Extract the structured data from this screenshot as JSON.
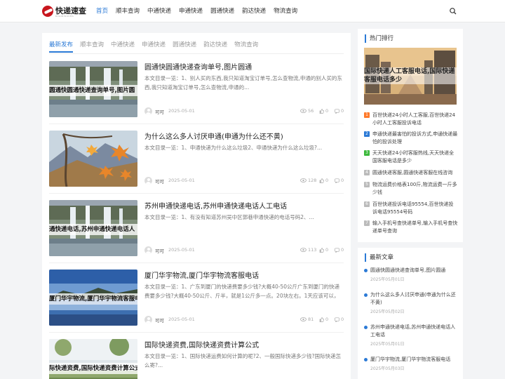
{
  "brand": {
    "name": "快递速查",
    "tagline": "KUAIDISUCHA"
  },
  "nav": [
    "首页",
    "顺丰查询",
    "中通快递",
    "申通快递",
    "圆通快递",
    "韵达快递",
    "物流查询"
  ],
  "tabs": [
    "最新发布",
    "顺丰查询",
    "中通快递",
    "申通快递",
    "圆通快递",
    "韵达快递",
    "物流查询"
  ],
  "posts": [
    {
      "thumb_text": "圆通快圆通快递查询单号,图片圆",
      "title": "圆通快圆通快递查询单号,图片圆通",
      "excerpt": "本文目录一览：1、别人买的东西,我只知道淘宝订单号,怎么查物流,申通的别人买的东西,我只知道淘宝订单号,怎么查物流,申通的...",
      "author": "可可",
      "date": "2025-05-01",
      "views": "56",
      "likes": "0",
      "comments": "0",
      "thumb_style": "waterfall"
    },
    {
      "thumb_text": "",
      "title": "为什么这么多人讨厌申通(申通为什么还不黄)",
      "excerpt": "本文目录一览：1、申通快递为什么这么垃圾2、申通快递为什么这么垃圾?...",
      "author": "可可",
      "date": "2025-05-01",
      "views": "128",
      "likes": "0",
      "comments": "0",
      "thumb_style": "autumn"
    },
    {
      "thumb_text": "通快递电话,苏州申通快递电话人",
      "title": "苏州申通快递电话,苏州申通快递电话人工电话",
      "excerpt": "本文目录一览：1、有没有知道苏州吴中区郭巷申通快递的电话号码2、...",
      "author": "可可",
      "date": "2025-05-01",
      "views": "113",
      "likes": "0",
      "comments": "0",
      "thumb_style": "waterfall"
    },
    {
      "thumb_text": "厦门华宇物流,厦门华宇物流客服电",
      "title": "厦门华宇物流,厦门华宇物流客服电话",
      "excerpt": "本文目录一览：1、广东到厦门的快递费要多少钱?大概40-50公斤广东到厦门的快递费要多少钱?大概40-50公斤、斤半，就是1公斤多一点。20块左右。1天应该可以，申通",
      "author": "可可",
      "date": "2025-05-01",
      "views": "81",
      "likes": "0",
      "comments": "0",
      "thumb_style": "lake"
    },
    {
      "thumb_text": "际快递资费,国际快递资费计算公式",
      "title": "国际快递资费,国际快递资费计算公式",
      "excerpt": "本文目录一览：1、国际快递运费如何计算的呢?2、一般国际快递多少钱?国际快递怎么寄?...",
      "author": "",
      "date": "",
      "views": "",
      "likes": "",
      "comments": "",
      "thumb_style": "meadow"
    }
  ],
  "hot": {
    "heading": "热门排行",
    "image_text": "国际快递人工客服电话,国际快递客服电话多少",
    "items": [
      {
        "num": "1",
        "text": "百世快递24小时人工客服,百世快递24小时人工客服投诉电话",
        "color": "#ff7a2b"
      },
      {
        "num": "2",
        "text": "申通快递最害怕的投诉方式,申通快递最怕的投诉处理",
        "color": "#2b7ad6"
      },
      {
        "num": "3",
        "text": "天天快递24小时客服热线,天天快递全国客服电话是多少",
        "color": "#3cb93c"
      },
      {
        "num": "4",
        "text": "圆通快递客服,圆通快递客服在线咨询",
        "color": "#b9b9b9"
      },
      {
        "num": "5",
        "text": "物流运费价格表100斤,物流运费一斤多少钱",
        "color": "#b9b9b9"
      },
      {
        "num": "6",
        "text": "百世快递投诉电话95554,百世快递投诉电话95554号码",
        "color": "#b9b9b9"
      },
      {
        "num": "7",
        "text": "输入手机号查快递单号,输入手机号查快递单号查询",
        "color": "#b9b9b9"
      }
    ]
  },
  "latest": {
    "heading": "最新文章",
    "items": [
      {
        "text": "圆通快圆通快递查询单号,图片圆通",
        "date": "2025年05月01日"
      },
      {
        "text": "为什么这么多人讨厌申通(申通为什么还不黄)",
        "date": "2025年05月02日"
      },
      {
        "text": "苏州申通快递电话,苏州申通快递电话人工电话",
        "date": "2025年05月01日"
      },
      {
        "text": "厦门华宇物流,厦门华宇物流客服电话",
        "date": "2025年05月03日"
      }
    ]
  },
  "colors": {
    "accent": "#2b7ad6",
    "rank_1": "#ff7a2b",
    "rank_2": "#2b7ad6",
    "rank_3": "#3cb93c"
  }
}
